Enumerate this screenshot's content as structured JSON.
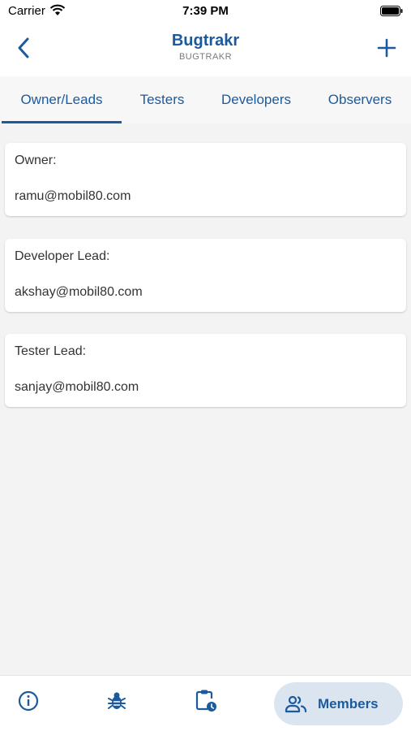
{
  "status": {
    "carrier": "Carrier",
    "time": "7:39 PM"
  },
  "header": {
    "title": "Bugtrakr",
    "subtitle": "BUGTRAKR"
  },
  "tabs": [
    {
      "label": "Owner/Leads",
      "active": true
    },
    {
      "label": "Testers",
      "active": false
    },
    {
      "label": "Developers",
      "active": false
    },
    {
      "label": "Observers",
      "active": false
    }
  ],
  "cards": [
    {
      "label": "Owner:",
      "value": "ramu@mobil80.com"
    },
    {
      "label": "Developer Lead:",
      "value": "akshay@mobil80.com"
    },
    {
      "label": "Tester Lead:",
      "value": "sanjay@mobil80.com"
    }
  ],
  "bottom_nav": {
    "items": [
      {
        "icon": "info-icon"
      },
      {
        "icon": "bug-icon"
      },
      {
        "icon": "clipboard-clock-icon"
      }
    ],
    "active": {
      "icon": "members-icon",
      "label": "Members"
    }
  },
  "colors": {
    "accent": "#1c5a9e",
    "pill_bg": "#dbe5f0",
    "background": "#f3f3f3"
  }
}
